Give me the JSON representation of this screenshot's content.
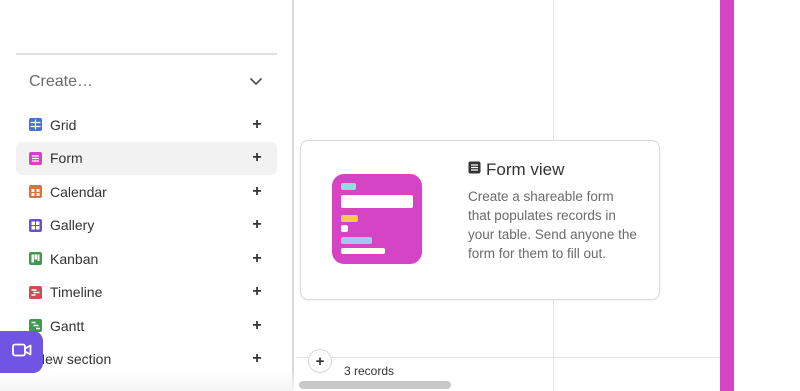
{
  "sidebar": {
    "create_label": "Create…",
    "items": [
      {
        "label": "Grid",
        "icon": "grid-icon",
        "color": "#4a6ed6"
      },
      {
        "label": "Form",
        "icon": "form-icon",
        "color": "#d544c4"
      },
      {
        "label": "Calendar",
        "icon": "calendar-icon",
        "color": "#e2703a"
      },
      {
        "label": "Gallery",
        "icon": "gallery-icon",
        "color": "#6a4fd6"
      },
      {
        "label": "Kanban",
        "icon": "kanban-icon",
        "color": "#3f9a4e"
      },
      {
        "label": "Timeline",
        "icon": "timeline-icon",
        "color": "#d24a56"
      },
      {
        "label": "Gantt",
        "icon": "gantt-icon",
        "color": "#3f9a4e"
      },
      {
        "label": "New section",
        "icon": "",
        "color": ""
      }
    ],
    "add_symbol": "+",
    "active_item": "Form"
  },
  "grid": {
    "records_count": "3 records",
    "add_row_symbol": "+"
  },
  "info_card": {
    "title": "Form view",
    "description": "Create a shareable form that populates records in your table. Send anyone the form for them to fill out."
  },
  "colors": {
    "accent": "#d544c4",
    "video_button": "#7054e4"
  }
}
